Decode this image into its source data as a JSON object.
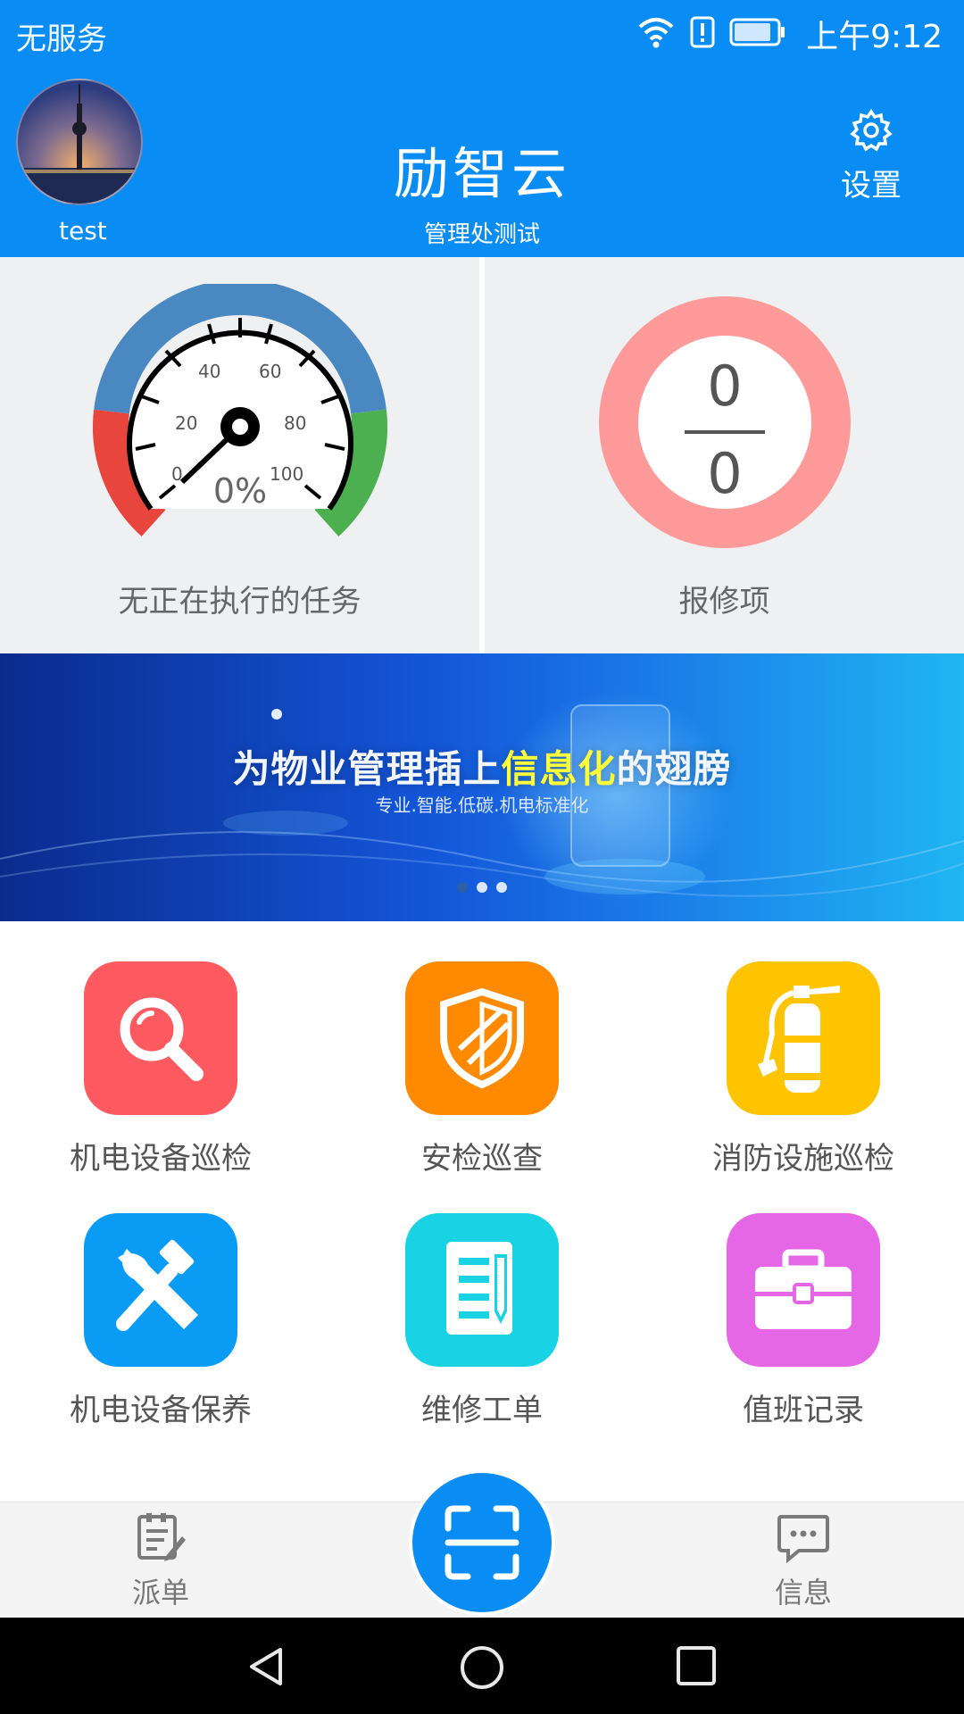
{
  "status_bar": {
    "carrier": "无服务",
    "time": "上午9:12",
    "icons": [
      "wifi-icon",
      "alert-icon",
      "battery-icon"
    ]
  },
  "header": {
    "title": "励智云",
    "subtitle": "管理处测试",
    "username": "test",
    "settings_label": "设置",
    "background_color": "#0a8cf5"
  },
  "stats": {
    "gauge": {
      "ticks": [
        "0",
        "20",
        "40",
        "60",
        "80",
        "100"
      ],
      "value_text": "0%",
      "label": "无正在执行的任务"
    },
    "repairs": {
      "numerator": "0",
      "denominator": "0",
      "label": "报修项",
      "ring_color": "#ff9a9a"
    }
  },
  "banner": {
    "title_prefix": "为物业管理插上",
    "title_highlight": "信息化",
    "title_suffix": "的翅膀",
    "subtitle": "专业.智能.低碳.机电标准化",
    "active_dot": 0,
    "dot_count": 3
  },
  "grid": {
    "items": [
      {
        "label": "机电设备巡检",
        "color": "#ff5a5f",
        "icon": "search-icon"
      },
      {
        "label": "安检巡查",
        "color": "#ff8a00",
        "icon": "shield-icon"
      },
      {
        "label": "消防设施巡检",
        "color": "#ffc400",
        "icon": "fire-extinguisher-icon"
      },
      {
        "label": "机电设备保养",
        "color": "#0a9cf5",
        "icon": "tools-icon"
      },
      {
        "label": "维修工单",
        "color": "#19d3e4",
        "icon": "document-icon"
      },
      {
        "label": "值班记录",
        "color": "#e567e6",
        "icon": "briefcase-icon"
      }
    ]
  },
  "bottom_nav": {
    "dispatch_label": "派单",
    "messages_label": "信息"
  }
}
